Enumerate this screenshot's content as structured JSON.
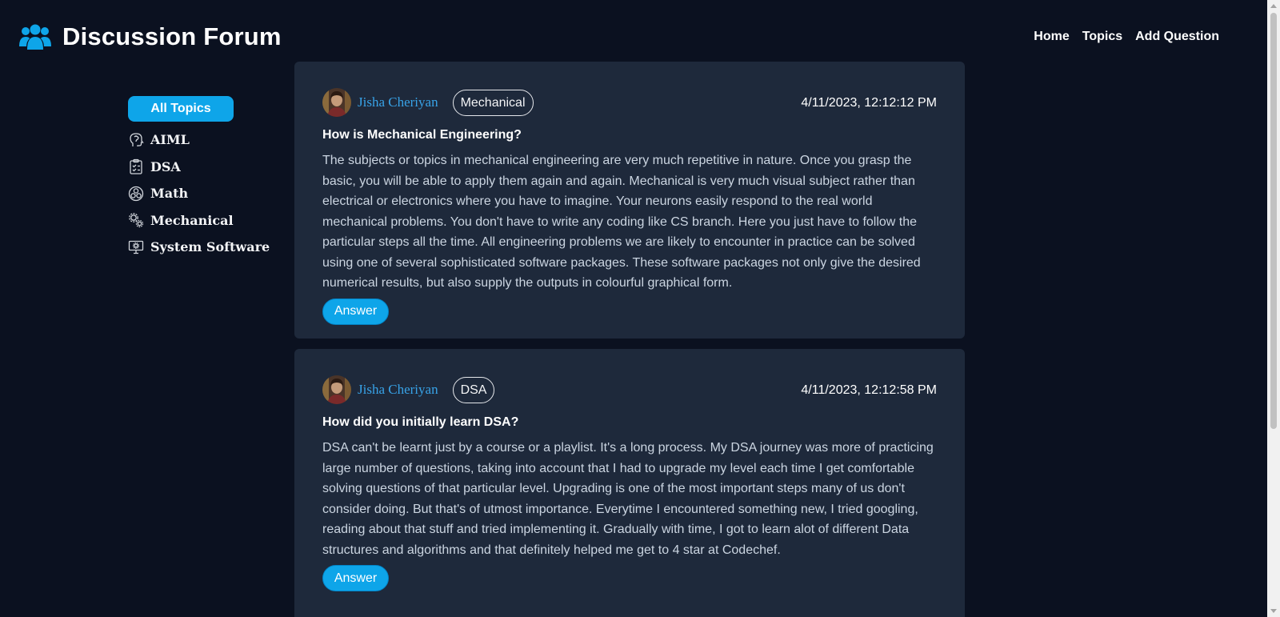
{
  "header": {
    "title": "Discussion Forum",
    "logo_icon": "users-icon",
    "nav": [
      {
        "label": "Home"
      },
      {
        "label": "Topics"
      },
      {
        "label": "Add Question"
      }
    ]
  },
  "sidebar": {
    "all_topics_label": "All Topics",
    "topics": [
      {
        "label": "AIML",
        "icon": "brain-icon"
      },
      {
        "label": "DSA",
        "icon": "clipboard-icon"
      },
      {
        "label": "Math",
        "icon": "atom-icon"
      },
      {
        "label": "Mechanical",
        "icon": "gears-icon"
      },
      {
        "label": "System Software",
        "icon": "monitor-gear-icon"
      }
    ]
  },
  "questions": [
    {
      "author": "Jisha Cheriyan",
      "tag": "Mechanical",
      "timestamp": "4/11/2023, 12:12:12 PM",
      "title": "How is Mechanical Engineering?",
      "body": "The subjects or topics in mechanical engineering are very much repetitive in nature. Once you grasp the basic, you will be able to apply them again and again. Mechanical is very much visual subject rather than electrical or electronics where you have to imagine. Your neurons easily respond to the real world mechanical problems. You don't have to write any coding like CS branch. Here you just have to follow the particular steps all the time. All engineering problems we are likely to encounter in practice can be solved using one of several sophisticated software packages. These software packages not only give the desired numerical results, but also supply the outputs in colourful graphical form.",
      "answer_label": "Answer"
    },
    {
      "author": "Jisha Cheriyan",
      "tag": "DSA",
      "timestamp": "4/11/2023, 12:12:58 PM",
      "title": "How did you initially learn DSA?",
      "body": "DSA can't be learnt just by a course or a playlist. It's a long process. My DSA journey was more of practicing large number of questions, taking into account that I had to upgrade my level each time I get comfortable solving questions of that particular level. Upgrading is one of the most important steps many of us don't consider doing. But that's of utmost importance. Everytime I encountered something new, I tried googling, reading about that stuff and tried implementing it. Gradually with time, I got to learn alot of different Data structures and algorithms and that definitely helped me get to 4 star at Codechef.",
      "answer_label": "Answer"
    }
  ],
  "colors": {
    "background": "#0b1120",
    "card": "#1e293b",
    "accent": "#0ea5e9",
    "author_link": "#38a3e8"
  }
}
